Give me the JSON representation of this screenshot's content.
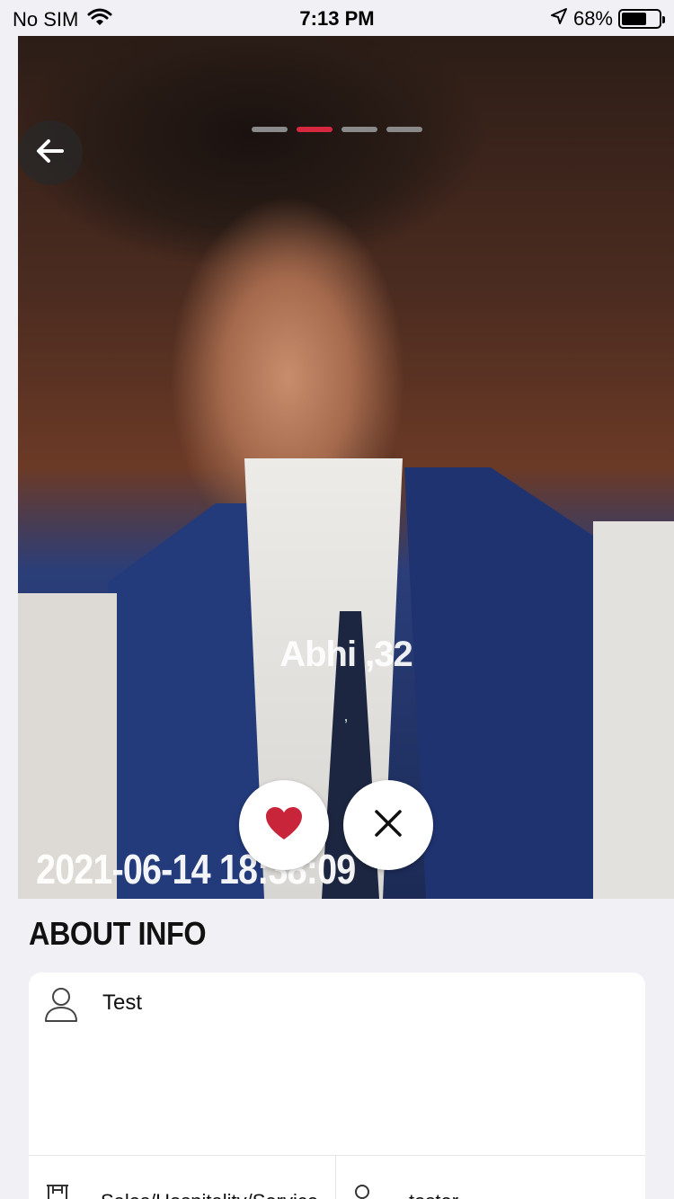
{
  "status_bar": {
    "carrier": "No SIM",
    "time": "7:13 PM",
    "battery_percent": "68%",
    "battery_level": 0.68
  },
  "photo": {
    "page_count": 4,
    "active_index": 1,
    "accent_color": "#d6283f"
  },
  "profile": {
    "name_age": "Abhi ,32",
    "subtitle": ",",
    "timestamp": "2021-06-14 18:38:09"
  },
  "actions": {
    "like_icon": "heart-icon",
    "pass_icon": "close-icon"
  },
  "about": {
    "title": "ABOUT INFO",
    "bio": "Test",
    "occupation": "Sales/Hospitality/Service",
    "job_title": "tester"
  }
}
